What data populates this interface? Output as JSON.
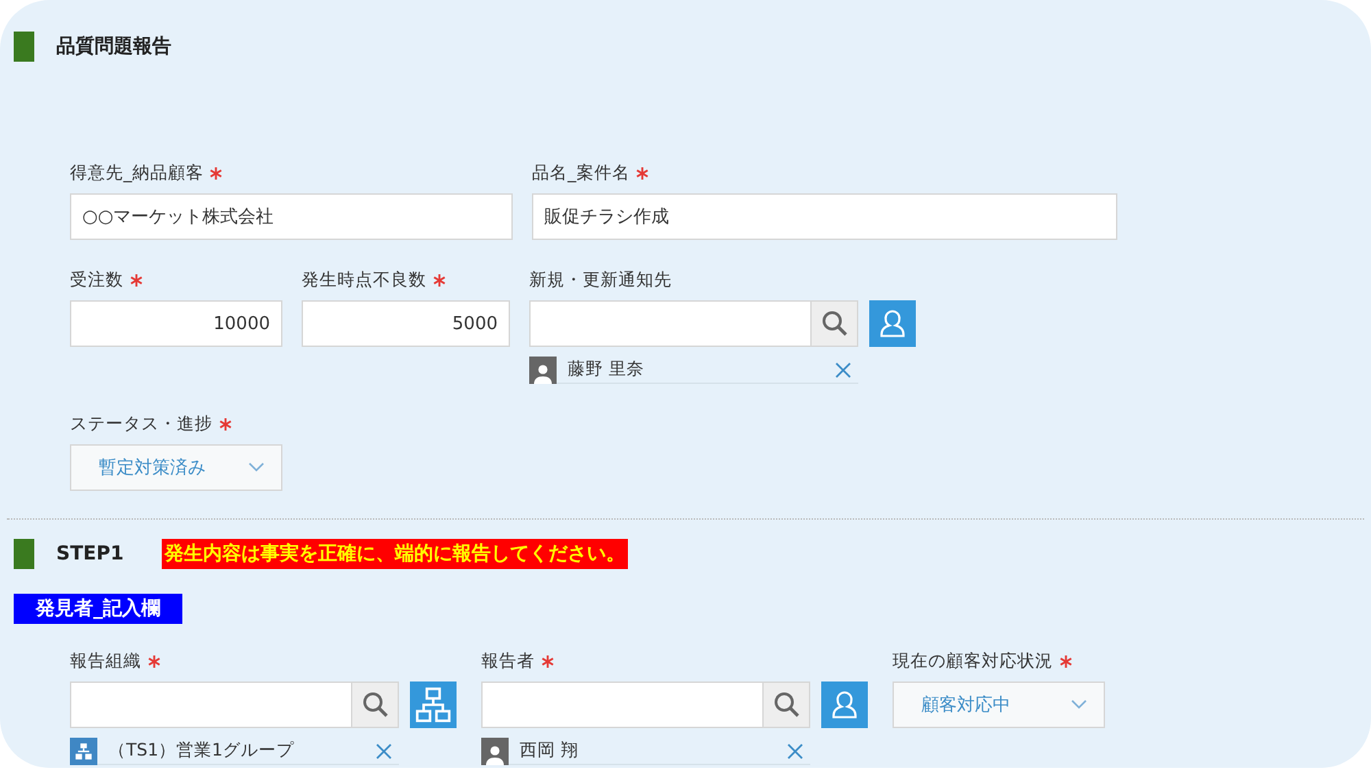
{
  "sections": [
    {
      "title": "品質問題報告",
      "fields": [
        {
          "label": "得意先_納品顧客",
          "required": true,
          "kind": "text",
          "value": "○○マーケット株式会社"
        },
        {
          "label": "品名_案件名",
          "required": true,
          "kind": "text",
          "value": "販促チラシ作成"
        },
        {
          "label": "受注数",
          "required": true,
          "kind": "number",
          "value": "10000"
        },
        {
          "label": "発生時点不良数",
          "required": true,
          "kind": "number",
          "value": "5000"
        },
        {
          "label": "新規・更新通知先",
          "required": false,
          "kind": "user-picker",
          "entries": [
            {
              "name": "藤野 里奈"
            }
          ]
        },
        {
          "label": "ステータス・進捗",
          "required": true,
          "kind": "select",
          "value": "暫定対策済み"
        }
      ]
    },
    {
      "title": "STEP1",
      "notice": "発生内容は事実を正確に、端的に報告してください。",
      "subheading": "発見者_記入欄",
      "fields": [
        {
          "label": "報告組織",
          "required": true,
          "kind": "org-picker",
          "entries": [
            {
              "name": "（TS1）営業1グループ"
            }
          ]
        },
        {
          "label": "報告者",
          "required": true,
          "kind": "user-picker",
          "entries": [
            {
              "name": "西岡 翔"
            }
          ]
        },
        {
          "label": "現在の顧客対応状況",
          "required": true,
          "kind": "select",
          "value": "顧客対応中"
        }
      ]
    }
  ]
}
